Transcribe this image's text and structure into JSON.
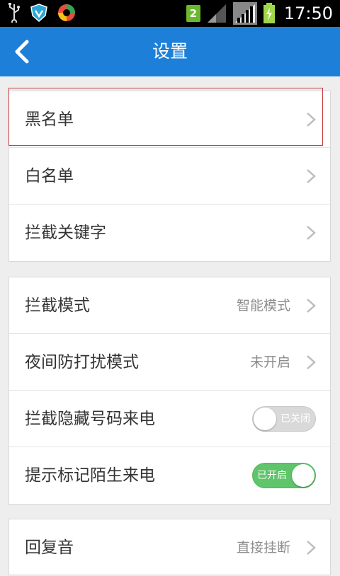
{
  "status_bar": {
    "badge": "2",
    "time": "17:50",
    "icons": [
      "usb-icon",
      "shield-icon",
      "app-icon",
      "signal-icon",
      "battery-icon"
    ]
  },
  "header": {
    "title": "设置",
    "back_icon": "chevron-left-icon"
  },
  "group1": {
    "items": [
      {
        "label": "黑名单"
      },
      {
        "label": "白名单"
      },
      {
        "label": "拦截关键字"
      }
    ]
  },
  "group2": {
    "items": [
      {
        "label": "拦截模式",
        "value": "智能模式"
      },
      {
        "label": "夜间防打扰模式",
        "value": "未开启"
      },
      {
        "label": "拦截隐藏号码来电",
        "toggle_text": "已关闭",
        "toggle_state": "off"
      },
      {
        "label": "提示标记陌生来电",
        "toggle_text": "已开启",
        "toggle_state": "on"
      }
    ]
  },
  "group3": {
    "items": [
      {
        "label": "回复音",
        "value": "直接挂断"
      }
    ]
  },
  "colors": {
    "header": "#1e7fd8",
    "toggle_on": "#5fc46a",
    "toggle_off": "#d9d9d9",
    "highlight": "#c63b3b"
  }
}
